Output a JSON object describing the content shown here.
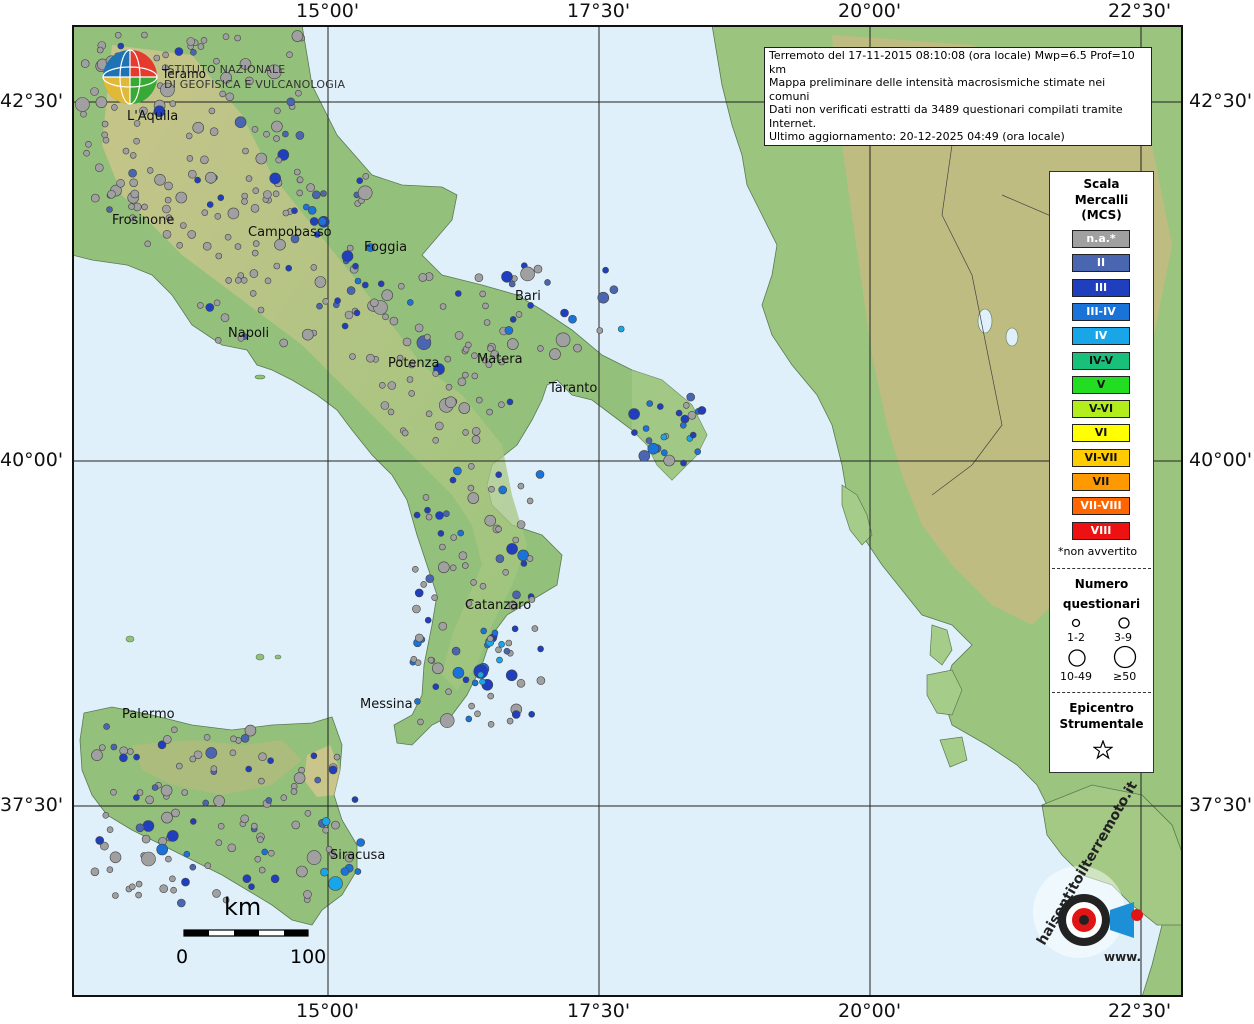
{
  "info": {
    "line1": "Terremoto del 17-11-2015 08:10:08 (ora locale) Mwp=6.5 Prof=10 km",
    "line2": "Mappa preliminare delle intensità macrosismiche stimate nei comuni",
    "line3": "Dati non verificati estratti da 3489 questionari compilati tramite Internet.",
    "line4": "Ultimo aggiornamento: 20-12-2025 04:49 (ora locale)"
  },
  "institute": {
    "line1": "ISTITUTO NAZIONALE",
    "line2": "DI GEOFISICA E VULCANOLOGIA"
  },
  "coords": {
    "top": [
      "15°00'",
      "17°30'",
      "20°00'",
      "22°30'"
    ],
    "bottom": [
      "15°00'",
      "17°30'",
      "20°00'",
      "22°30'"
    ],
    "left": [
      "42°30'",
      "40°00'",
      "37°30'"
    ],
    "right": [
      "42°30'",
      "40°00'",
      "37°30'"
    ]
  },
  "legend": {
    "title": [
      "Scala",
      "Mercalli",
      "(MCS)"
    ],
    "classes": [
      {
        "label": "n.a.*",
        "color": "#a0a0a0",
        "text": "#ffffff"
      },
      {
        "label": "II",
        "color": "#4a66b0",
        "text": "#ffffff"
      },
      {
        "label": "III",
        "color": "#1f3fbf",
        "text": "#ffffff"
      },
      {
        "label": "III-IV",
        "color": "#1a73d9",
        "text": "#ffffff"
      },
      {
        "label": "IV",
        "color": "#19a6e8",
        "text": "#ffffff"
      },
      {
        "label": "IV-V",
        "color": "#19c07a",
        "text": "#111111"
      },
      {
        "label": "V",
        "color": "#22dd22",
        "text": "#111111"
      },
      {
        "label": "V-VI",
        "color": "#b2ee1c",
        "text": "#111111"
      },
      {
        "label": "VI",
        "color": "#ffff00",
        "text": "#111111"
      },
      {
        "label": "VI-VII",
        "color": "#ffcc00",
        "text": "#111111"
      },
      {
        "label": "VII",
        "color": "#ff9900",
        "text": "#111111"
      },
      {
        "label": "VII-VIII",
        "color": "#ff6600",
        "text": "#ffffff"
      },
      {
        "label": "VIII",
        "color": "#ee1111",
        "text": "#ffffff"
      }
    ],
    "not_felt": "*non avvertito",
    "count_title": [
      "Numero",
      "questionari"
    ],
    "count_classes": [
      "1-2",
      "3-9",
      "10-49",
      "≥50"
    ],
    "epicenter_title": [
      "Epicentro",
      "Strumentale"
    ]
  },
  "scale": {
    "unit": "km",
    "min": "0",
    "max": "100"
  },
  "cities": [
    "L'Aquila",
    "Teramo",
    "Frosinone",
    "Campobasso",
    "Foggia",
    "Napoli",
    "Bari",
    "Potenza",
    "Matera",
    "Taranto",
    "Catanzaro",
    "Palermo",
    "Messina",
    "Siracusa"
  ],
  "brand": {
    "site": "haisentitoilterremoto.it",
    "prefix": "www."
  },
  "colors": {
    "sea": "#dff0fa",
    "land": "#8fbf74",
    "mountain": "#c9b27c",
    "grid": "#222222",
    "frame": "#111111"
  }
}
